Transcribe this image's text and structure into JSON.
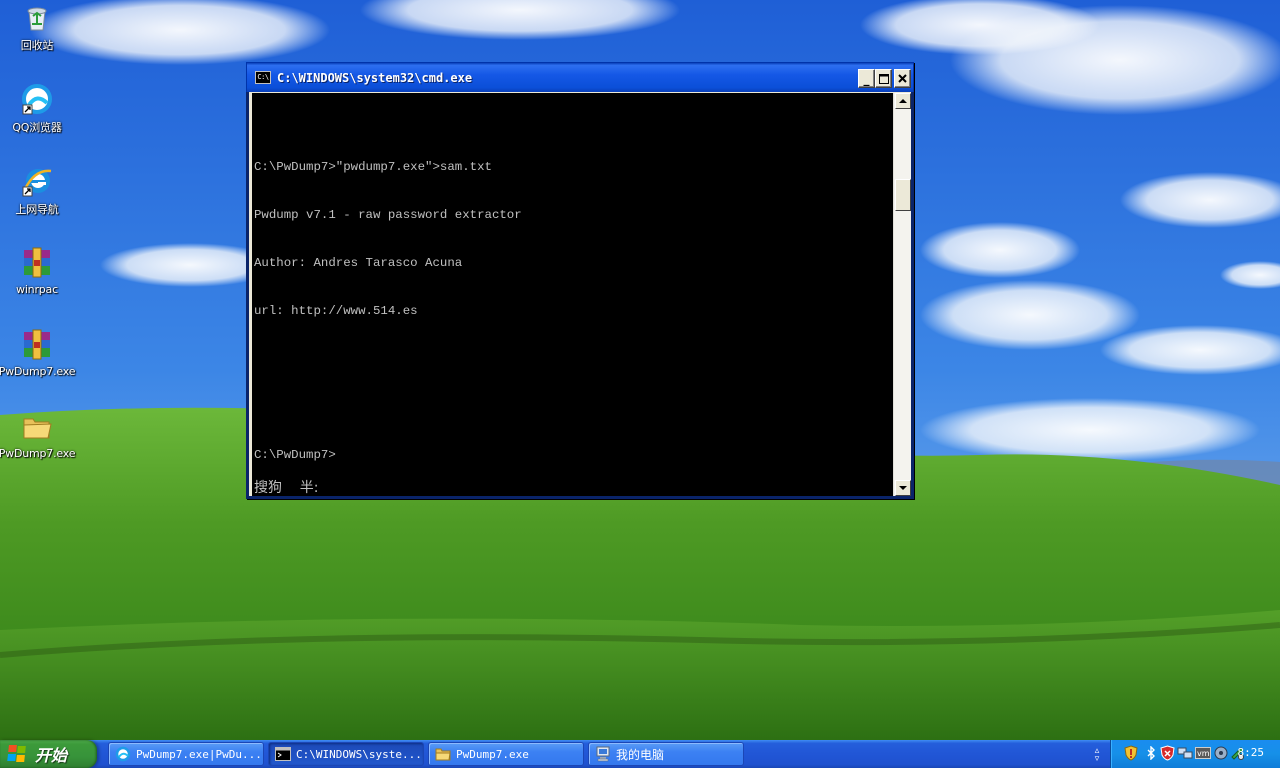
{
  "desktop": {
    "icons": [
      {
        "label": "回收站",
        "icon": "recycle-bin-icon"
      },
      {
        "label": "QQ浏览器",
        "icon": "qq-browser-icon"
      },
      {
        "label": "上网导航",
        "icon": "internet-explorer-icon"
      },
      {
        "label": "winrpac",
        "icon": "winrar-archive-icon"
      },
      {
        "label": "PwDump7.exe",
        "icon": "winrar-archive-icon"
      },
      {
        "label": "PwDump7.exe",
        "icon": "folder-icon"
      }
    ]
  },
  "cmd_window": {
    "title": "C:\\WINDOWS\\system32\\cmd.exe",
    "icon_text": "C:\\",
    "lines": [
      "C:\\PwDump7>\"pwdump7.exe\">sam.txt",
      "Pwdump v7.1 - raw password extractor",
      "Author: Andres Tarasco Acuna",
      "url: http://www.514.es",
      "",
      "",
      "C:\\PwDump7>"
    ],
    "ime_status": "搜狗    半:"
  },
  "taskbar": {
    "start_label": "开始",
    "tasks": [
      {
        "label": "PwDump7.exe|PwDu...",
        "icon": "qq-browser-icon",
        "active": false
      },
      {
        "label": "C:\\WINDOWS\\syste...",
        "icon": "cmd-icon",
        "active": true
      },
      {
        "label": "PwDump7.exe",
        "icon": "folder-icon",
        "active": false
      },
      {
        "label": "我的电脑",
        "icon": "my-computer-icon",
        "active": false
      }
    ],
    "clock": "8:25"
  },
  "colors": {
    "titlebar": "#0b4fd8",
    "taskbar": "#245edb",
    "start_button": "#3c9a3a",
    "tray": "#1690e8",
    "console_text": "#c0c0c0"
  }
}
